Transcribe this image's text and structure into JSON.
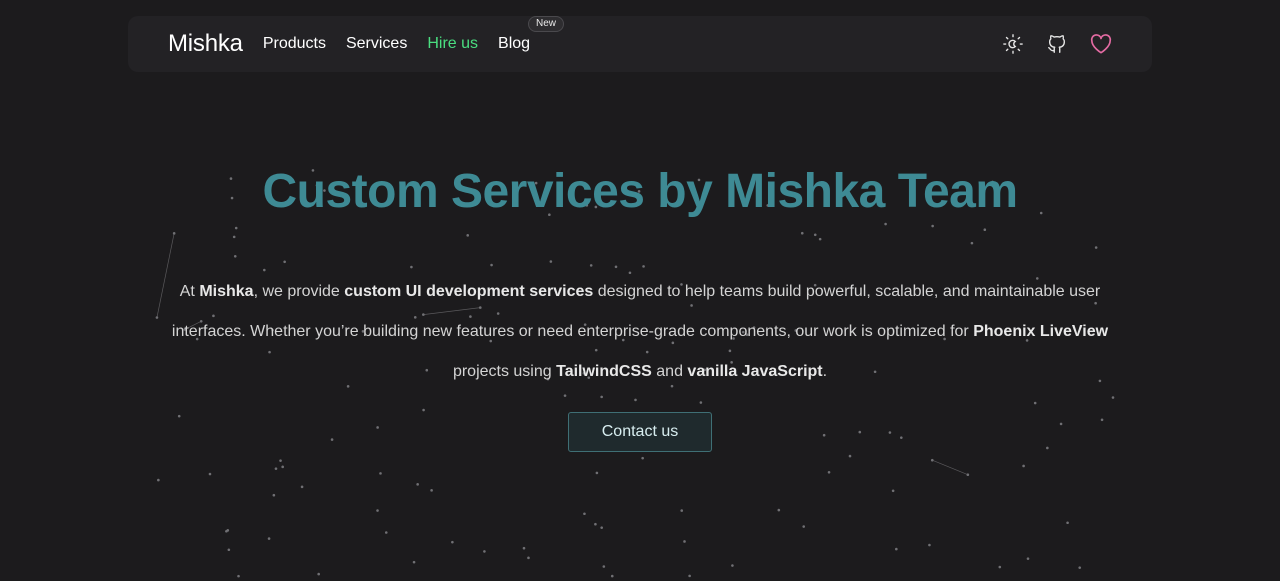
{
  "nav": {
    "brand": "Mishka",
    "links": [
      {
        "label": "Products"
      },
      {
        "label": "Services"
      },
      {
        "label": "Hire us"
      },
      {
        "label": "Blog",
        "badge": "New"
      }
    ],
    "icons": [
      "theme-toggle-icon",
      "github-icon",
      "heart-icon"
    ],
    "active_color": "#4ade80",
    "heart_color": "#e46ba3"
  },
  "hero": {
    "title": "Custom Services by Mishka Team",
    "title_color": "#3e8a94",
    "desc": [
      {
        "t": "At "
      },
      {
        "t": "Mishka",
        "b": true
      },
      {
        "t": ", we provide "
      },
      {
        "t": "custom UI development services",
        "b": true
      },
      {
        "t": " designed to help teams build powerful, scalable, and maintainable user interfaces. Whether you’re building new features or need enterprise-grade components, our work is optimized for "
      },
      {
        "t": "Phoenix LiveView",
        "b": true
      },
      {
        "t": " projects using "
      },
      {
        "t": "TailwindCSS",
        "b": true
      },
      {
        "t": " and "
      },
      {
        "t": "vanilla JavaScript",
        "b": true
      },
      {
        "t": "."
      }
    ],
    "cta": "Contact us"
  }
}
